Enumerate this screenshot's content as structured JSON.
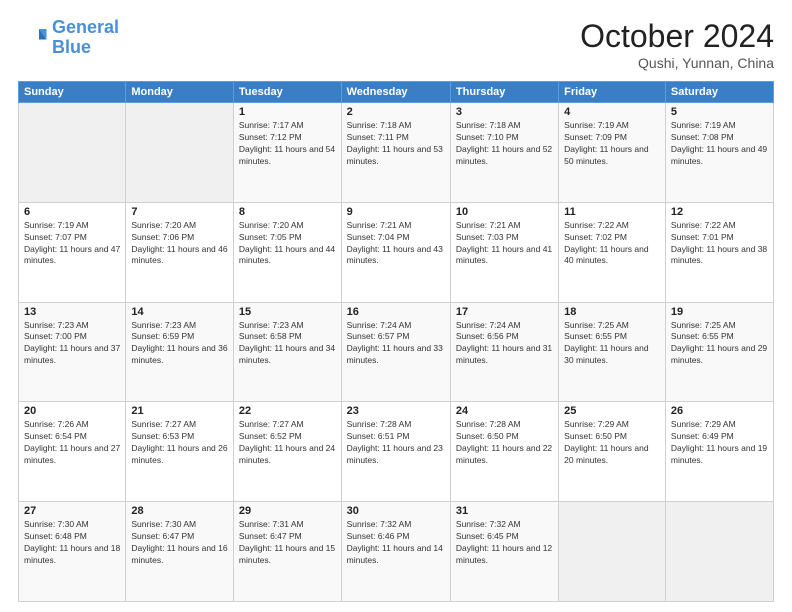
{
  "header": {
    "logo_general": "General",
    "logo_blue": "Blue",
    "title": "October 2024",
    "subtitle": "Qushi, Yunnan, China"
  },
  "weekdays": [
    "Sunday",
    "Monday",
    "Tuesday",
    "Wednesday",
    "Thursday",
    "Friday",
    "Saturday"
  ],
  "weeks": [
    [
      {
        "day": "",
        "info": ""
      },
      {
        "day": "",
        "info": ""
      },
      {
        "day": "1",
        "info": "Sunrise: 7:17 AM\nSunset: 7:12 PM\nDaylight: 11 hours and 54 minutes."
      },
      {
        "day": "2",
        "info": "Sunrise: 7:18 AM\nSunset: 7:11 PM\nDaylight: 11 hours and 53 minutes."
      },
      {
        "day": "3",
        "info": "Sunrise: 7:18 AM\nSunset: 7:10 PM\nDaylight: 11 hours and 52 minutes."
      },
      {
        "day": "4",
        "info": "Sunrise: 7:19 AM\nSunset: 7:09 PM\nDaylight: 11 hours and 50 minutes."
      },
      {
        "day": "5",
        "info": "Sunrise: 7:19 AM\nSunset: 7:08 PM\nDaylight: 11 hours and 49 minutes."
      }
    ],
    [
      {
        "day": "6",
        "info": "Sunrise: 7:19 AM\nSunset: 7:07 PM\nDaylight: 11 hours and 47 minutes."
      },
      {
        "day": "7",
        "info": "Sunrise: 7:20 AM\nSunset: 7:06 PM\nDaylight: 11 hours and 46 minutes."
      },
      {
        "day": "8",
        "info": "Sunrise: 7:20 AM\nSunset: 7:05 PM\nDaylight: 11 hours and 44 minutes."
      },
      {
        "day": "9",
        "info": "Sunrise: 7:21 AM\nSunset: 7:04 PM\nDaylight: 11 hours and 43 minutes."
      },
      {
        "day": "10",
        "info": "Sunrise: 7:21 AM\nSunset: 7:03 PM\nDaylight: 11 hours and 41 minutes."
      },
      {
        "day": "11",
        "info": "Sunrise: 7:22 AM\nSunset: 7:02 PM\nDaylight: 11 hours and 40 minutes."
      },
      {
        "day": "12",
        "info": "Sunrise: 7:22 AM\nSunset: 7:01 PM\nDaylight: 11 hours and 38 minutes."
      }
    ],
    [
      {
        "day": "13",
        "info": "Sunrise: 7:23 AM\nSunset: 7:00 PM\nDaylight: 11 hours and 37 minutes."
      },
      {
        "day": "14",
        "info": "Sunrise: 7:23 AM\nSunset: 6:59 PM\nDaylight: 11 hours and 36 minutes."
      },
      {
        "day": "15",
        "info": "Sunrise: 7:23 AM\nSunset: 6:58 PM\nDaylight: 11 hours and 34 minutes."
      },
      {
        "day": "16",
        "info": "Sunrise: 7:24 AM\nSunset: 6:57 PM\nDaylight: 11 hours and 33 minutes."
      },
      {
        "day": "17",
        "info": "Sunrise: 7:24 AM\nSunset: 6:56 PM\nDaylight: 11 hours and 31 minutes."
      },
      {
        "day": "18",
        "info": "Sunrise: 7:25 AM\nSunset: 6:55 PM\nDaylight: 11 hours and 30 minutes."
      },
      {
        "day": "19",
        "info": "Sunrise: 7:25 AM\nSunset: 6:55 PM\nDaylight: 11 hours and 29 minutes."
      }
    ],
    [
      {
        "day": "20",
        "info": "Sunrise: 7:26 AM\nSunset: 6:54 PM\nDaylight: 11 hours and 27 minutes."
      },
      {
        "day": "21",
        "info": "Sunrise: 7:27 AM\nSunset: 6:53 PM\nDaylight: 11 hours and 26 minutes."
      },
      {
        "day": "22",
        "info": "Sunrise: 7:27 AM\nSunset: 6:52 PM\nDaylight: 11 hours and 24 minutes."
      },
      {
        "day": "23",
        "info": "Sunrise: 7:28 AM\nSunset: 6:51 PM\nDaylight: 11 hours and 23 minutes."
      },
      {
        "day": "24",
        "info": "Sunrise: 7:28 AM\nSunset: 6:50 PM\nDaylight: 11 hours and 22 minutes."
      },
      {
        "day": "25",
        "info": "Sunrise: 7:29 AM\nSunset: 6:50 PM\nDaylight: 11 hours and 20 minutes."
      },
      {
        "day": "26",
        "info": "Sunrise: 7:29 AM\nSunset: 6:49 PM\nDaylight: 11 hours and 19 minutes."
      }
    ],
    [
      {
        "day": "27",
        "info": "Sunrise: 7:30 AM\nSunset: 6:48 PM\nDaylight: 11 hours and 18 minutes."
      },
      {
        "day": "28",
        "info": "Sunrise: 7:30 AM\nSunset: 6:47 PM\nDaylight: 11 hours and 16 minutes."
      },
      {
        "day": "29",
        "info": "Sunrise: 7:31 AM\nSunset: 6:47 PM\nDaylight: 11 hours and 15 minutes."
      },
      {
        "day": "30",
        "info": "Sunrise: 7:32 AM\nSunset: 6:46 PM\nDaylight: 11 hours and 14 minutes."
      },
      {
        "day": "31",
        "info": "Sunrise: 7:32 AM\nSunset: 6:45 PM\nDaylight: 11 hours and 12 minutes."
      },
      {
        "day": "",
        "info": ""
      },
      {
        "day": "",
        "info": ""
      }
    ]
  ]
}
